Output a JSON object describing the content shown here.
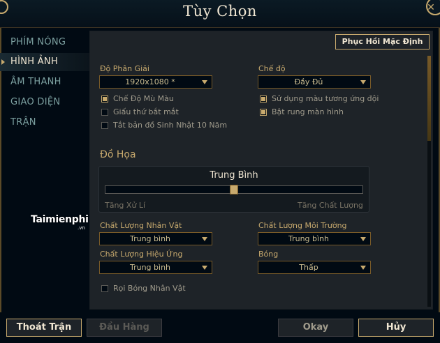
{
  "window": {
    "title": "Tùy Chọn",
    "close_glyph": "✕"
  },
  "sidebar": {
    "items": [
      {
        "label": "PHÍM NÓNG",
        "active": false
      },
      {
        "label": "HÌNH ẢNH",
        "active": true
      },
      {
        "label": "ÂM THANH",
        "active": false
      },
      {
        "label": "GIAO DIỆN",
        "active": false
      },
      {
        "label": "TRẬN",
        "active": false
      }
    ]
  },
  "header": {
    "reset_label": "Phục Hồi Mặc Định"
  },
  "video": {
    "resolution": {
      "label": "Độ Phân Giải",
      "value": "1920x1080 *"
    },
    "mode": {
      "label": "Chế độ",
      "value": "Đầy Đủ"
    },
    "left_checks": [
      {
        "label": "Chế Độ Mù Màu",
        "checked": true
      },
      {
        "label": "Giấu thứ bắt mắt",
        "checked": false
      },
      {
        "label": "Tắt bản đồ Sinh Nhật 10 Năm",
        "checked": false
      }
    ],
    "right_checks": [
      {
        "label": "Sử dụng màu tương ứng đội",
        "checked": true
      },
      {
        "label": "Bật rung màn hình",
        "checked": true
      }
    ]
  },
  "graphics": {
    "section_title": "Đồ Họa",
    "slider": {
      "value_label": "Trung Bình",
      "min_label": "Tăng Xử Lí",
      "max_label": "Tăng Chất Lượng",
      "position": 0.5
    },
    "character_quality": {
      "label": "Chất Lượng Nhân Vật",
      "value": "Trung bình"
    },
    "environment_quality": {
      "label": "Chất Lượng Môi Trường",
      "value": "Trung bình"
    },
    "effects_quality": {
      "label": "Chất Lượng Hiệu Ứng",
      "value": "Trung bình"
    },
    "shadows": {
      "label": "Bóng",
      "value": "Thấp"
    },
    "character_shadow": {
      "label": "Rọi Bóng Nhân Vật",
      "checked": false
    }
  },
  "footer": {
    "exit_game": "Thoát Trận",
    "surrender": "Đầu Hàng",
    "ok": "Okay",
    "cancel": "Hủy"
  },
  "watermark": {
    "brand": "Taimienphi",
    "suffix": ".vn"
  },
  "colors": {
    "gold": "#c8aa6e",
    "panel": "#1e2328",
    "background": "#010a13",
    "teal_text": "#7ca0a0"
  }
}
